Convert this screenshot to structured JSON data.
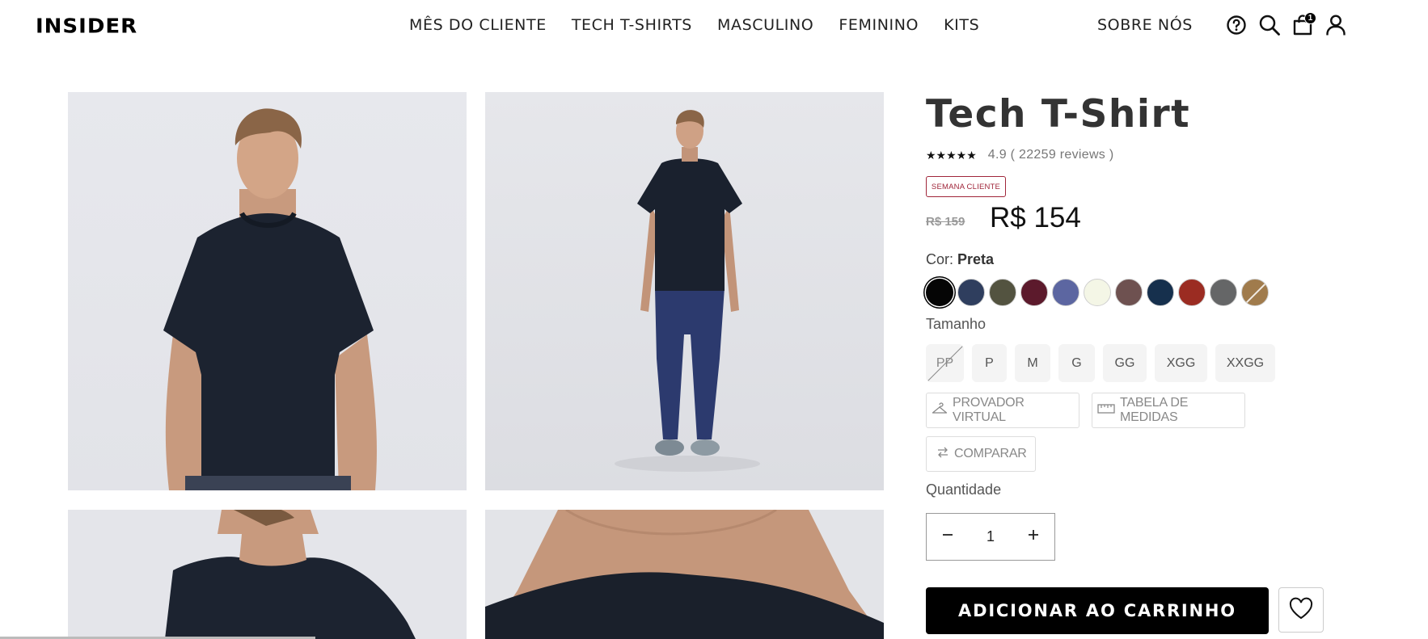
{
  "header": {
    "logo": "INSIDER",
    "nav": [
      "MÊS DO CLIENTE",
      "TECH T-SHIRTS",
      "MASCULINO",
      "FEMININO",
      "KITS"
    ],
    "about": "SOBRE NÓS",
    "cart_count": "1",
    "icons": [
      "help-icon",
      "search-icon",
      "cart-icon",
      "user-icon"
    ]
  },
  "product": {
    "title": "Tech T-Shirt",
    "stars": "★★★★★",
    "rating_text": "4.9 ( 22259 reviews )",
    "badge": "SEMANA CLIENTE",
    "old_price": "R$ 159",
    "price": "R$ 154",
    "color_label": "Cor:",
    "color_value": "Preta",
    "swatches": [
      "#050505",
      "#2f3e5e",
      "#535340",
      "#5c1a2c",
      "#5c66a1",
      "#f4f6e6",
      "#6e5150",
      "#16304d",
      "#9b2c22",
      "#656667",
      "#a07b4c"
    ],
    "size_label": "Tamanho",
    "sizes": [
      "PP",
      "P",
      "M",
      "G",
      "GG",
      "XGG",
      "XXGG"
    ],
    "virtual_fitting": "PROVADOR VIRTUAL",
    "size_chart": "TABELA DE MEDIDAS",
    "compare": "COMPARAR",
    "quantity_label": "Quantidade",
    "quantity": "1",
    "add_to_cart": "ADICIONAR AO CARRINHO"
  }
}
